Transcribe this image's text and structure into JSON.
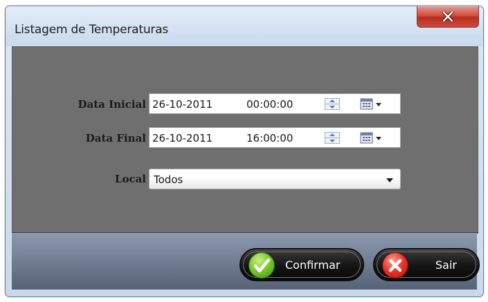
{
  "window": {
    "title": "Listagem de Temperaturas"
  },
  "form": {
    "data_inicial": {
      "label": "Data Inicial",
      "date": "26-10-2011",
      "time": "00:00:00"
    },
    "data_final": {
      "label": "Data Final",
      "date": "26-10-2011",
      "time": "16:00:00"
    },
    "local": {
      "label": "Local",
      "value": "Todos"
    }
  },
  "buttons": {
    "confirmar": {
      "label": "Confirmar",
      "icon": "check-icon",
      "color": "#5cb82a"
    },
    "sair": {
      "label": "Sair",
      "icon": "close-x-icon",
      "color": "#d8261c"
    }
  }
}
